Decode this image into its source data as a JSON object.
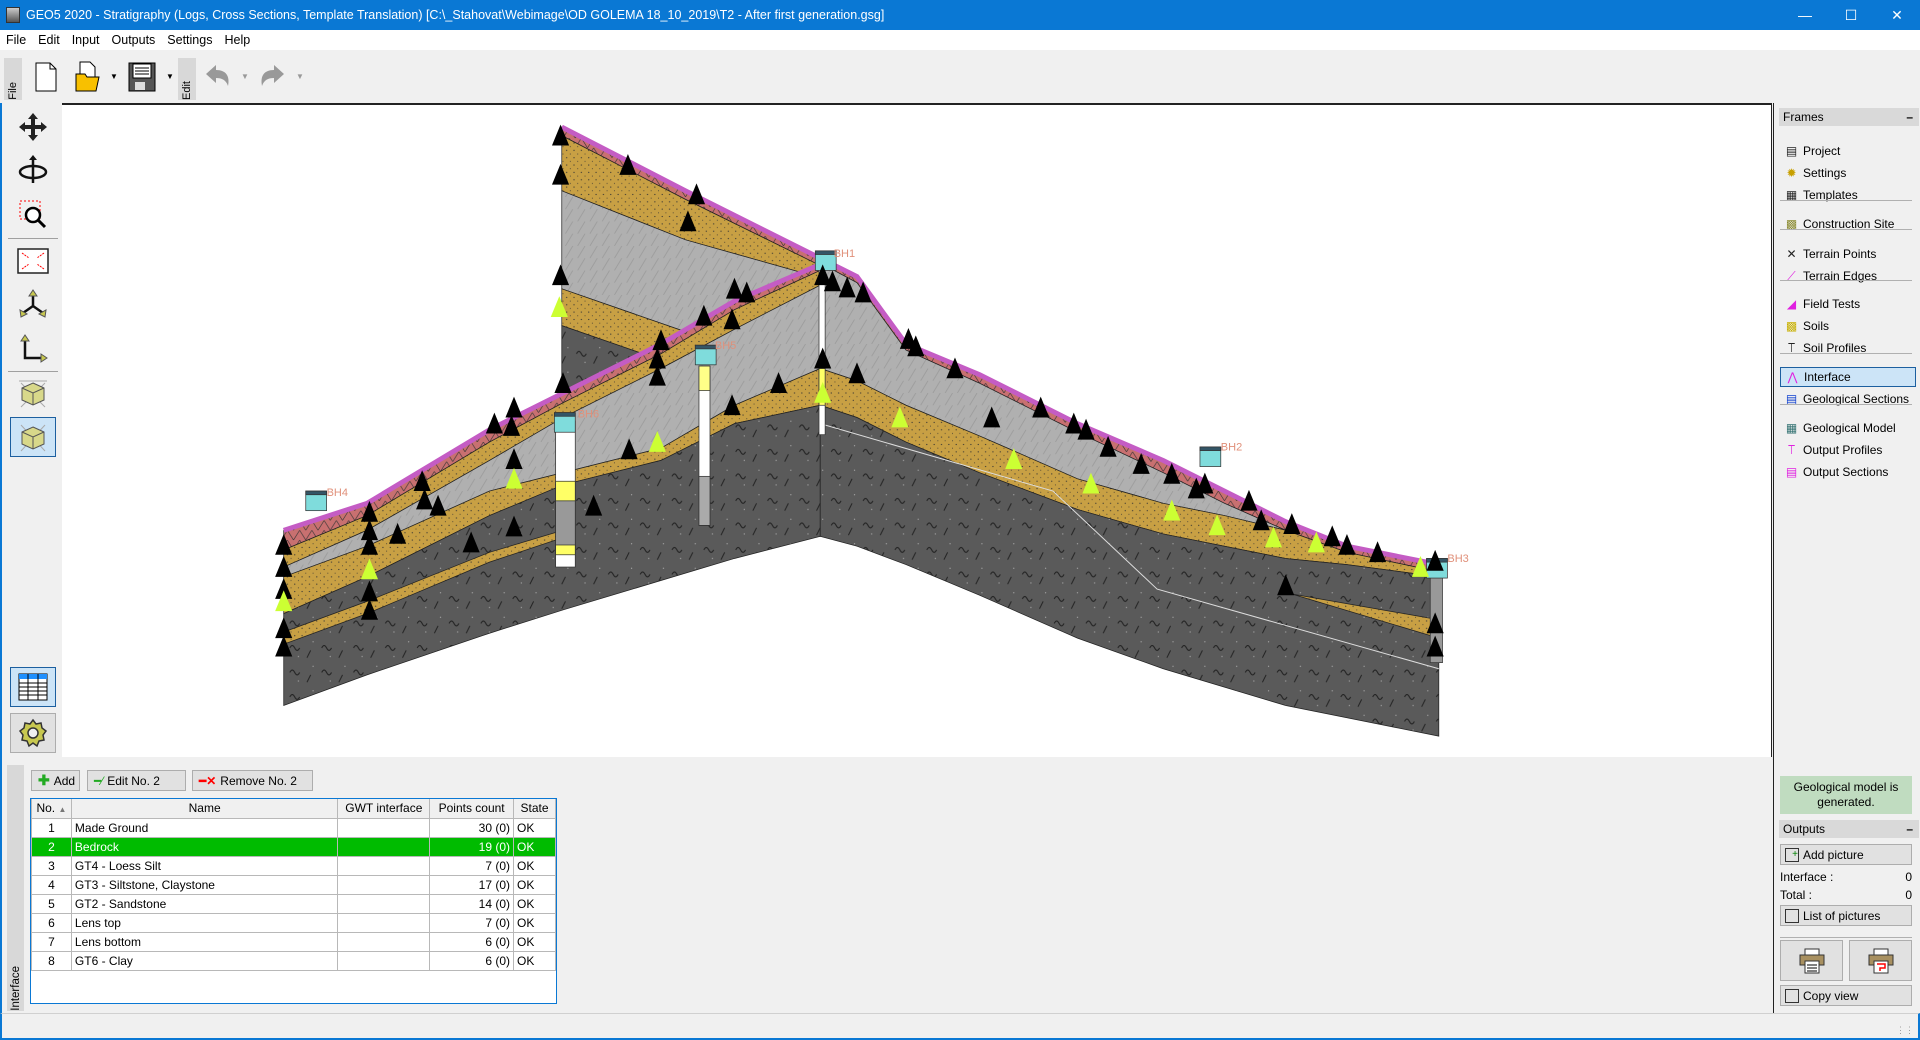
{
  "window": {
    "title": "GEO5 2020 - Stratigraphy (Logs, Cross Sections, Template Translation) [C:\\_Stahovat\\Webimage\\OD GOLEMA 18_10_2019\\T2 -  After first generation.gsg]",
    "accent": "#0a78d4"
  },
  "menu": [
    "File",
    "Edit",
    "Input",
    "Outputs",
    "Settings",
    "Help"
  ],
  "toolbar": {
    "file_tab": "File",
    "edit_tab": "Edit"
  },
  "model": {
    "boreholes": [
      "BH1",
      "BH2",
      "BH3",
      "BH4",
      "BH5",
      "BH6"
    ],
    "colors": {
      "terrain": "#c45cc4",
      "made_ground": "#c87070",
      "sand": "#c8a044",
      "silt": "#b0b0b0",
      "bedrock": "#5a5a5a",
      "point": "#000000",
      "gwt_point": "#ccff33",
      "borehole_head": "#7fdcdc"
    }
  },
  "frames": {
    "title": "Frames",
    "items": [
      {
        "label": "Project",
        "icon": "project-icon"
      },
      {
        "label": "Settings",
        "icon": "settings-icon"
      },
      {
        "label": "Templates",
        "icon": "templates-icon"
      },
      {
        "label": "Construction Site",
        "icon": "construction-site-icon"
      },
      {
        "label": "Terrain Points",
        "icon": "terrain-points-icon"
      },
      {
        "label": "Terrain Edges",
        "icon": "terrain-edges-icon"
      },
      {
        "label": "Field Tests",
        "icon": "field-tests-icon"
      },
      {
        "label": "Soils",
        "icon": "soils-icon"
      },
      {
        "label": "Soil Profiles",
        "icon": "soil-profiles-icon"
      },
      {
        "label": "Interface",
        "icon": "interface-icon",
        "selected": true
      },
      {
        "label": "Geological Sections",
        "icon": "geological-sections-icon"
      },
      {
        "label": "Geological Model",
        "icon": "geological-model-icon"
      },
      {
        "label": "Output Profiles",
        "icon": "output-profiles-icon"
      },
      {
        "label": "Output Sections",
        "icon": "output-sections-icon"
      }
    ]
  },
  "status_message": "Geological model is generated.",
  "outputs": {
    "title": "Outputs",
    "add_picture": "Add picture",
    "interface_label": "Interface :",
    "interface_value": "0",
    "total_label": "Total :",
    "total_value": "0",
    "list_of_pictures": "List of pictures",
    "copy_view": "Copy view"
  },
  "interface_panel": {
    "tab_label": "Interface",
    "add": "Add",
    "edit": "Edit No. 2",
    "remove": "Remove No. 2",
    "columns": [
      "No.",
      "Name",
      "GWT interface",
      "Points count",
      "State"
    ],
    "rows": [
      {
        "no": "1",
        "name": "Made Ground",
        "gwt": "",
        "points": "30 (0)",
        "state": "OK"
      },
      {
        "no": "2",
        "name": "Bedrock",
        "gwt": "",
        "points": "19 (0)",
        "state": "OK",
        "selected": true
      },
      {
        "no": "3",
        "name": "GT4 - Loess Silt",
        "gwt": "",
        "points": "7 (0)",
        "state": "OK"
      },
      {
        "no": "4",
        "name": "GT3 - Siltstone, Claystone",
        "gwt": "",
        "points": "17 (0)",
        "state": "OK"
      },
      {
        "no": "5",
        "name": "GT2 - Sandstone",
        "gwt": "",
        "points": "14 (0)",
        "state": "OK"
      },
      {
        "no": "6",
        "name": "Lens top",
        "gwt": "",
        "points": "7 (0)",
        "state": "OK"
      },
      {
        "no": "7",
        "name": "Lens bottom",
        "gwt": "",
        "points": "6 (0)",
        "state": "OK"
      },
      {
        "no": "8",
        "name": "GT6 - Clay",
        "gwt": "",
        "points": "6 (0)",
        "state": "OK"
      }
    ],
    "selected_color": "#00bb00"
  }
}
